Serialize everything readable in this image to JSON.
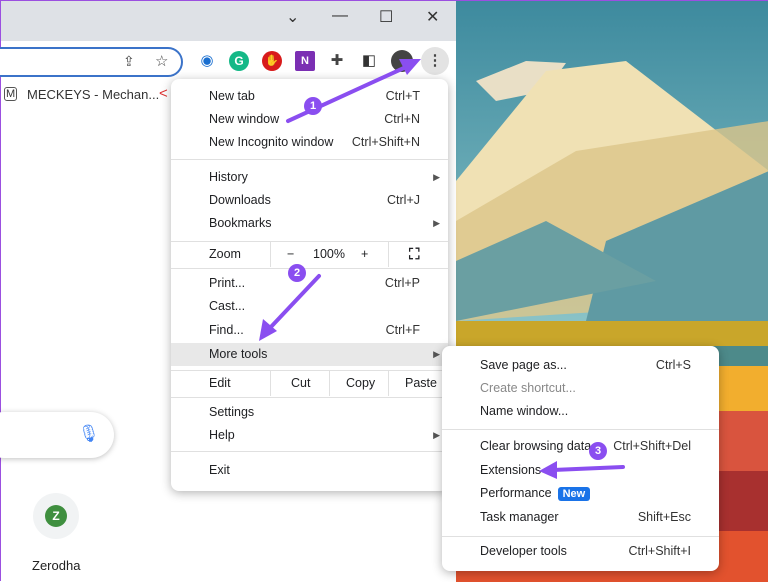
{
  "window": {
    "controls": [
      "chevron-down",
      "minimize",
      "maximize",
      "close"
    ]
  },
  "toolbar": {
    "extensions": [
      "1password",
      "grammarly",
      "adblock",
      "onenote",
      "extensions-puzzle",
      "side-panel",
      "profile-avatar",
      "menu-kebab"
    ]
  },
  "bookmarks": [
    {
      "label": "MECKEYS - Mechan..."
    }
  ],
  "shortcut": {
    "letter": "Z",
    "label": "Zerodha"
  },
  "main_menu": {
    "new_tab": {
      "label": "New tab",
      "shortcut": "Ctrl+T"
    },
    "new_window": {
      "label": "New window",
      "shortcut": "Ctrl+N"
    },
    "incognito": {
      "label": "New Incognito window",
      "shortcut": "Ctrl+Shift+N"
    },
    "history": {
      "label": "History"
    },
    "downloads": {
      "label": "Downloads",
      "shortcut": "Ctrl+J"
    },
    "bookmarks": {
      "label": "Bookmarks"
    },
    "zoom": {
      "label": "Zoom",
      "minus": "−",
      "value": "100%",
      "plus": "+"
    },
    "print": {
      "label": "Print...",
      "shortcut": "Ctrl+P"
    },
    "cast": {
      "label": "Cast..."
    },
    "find": {
      "label": "Find...",
      "shortcut": "Ctrl+F"
    },
    "more_tools": {
      "label": "More tools"
    },
    "edit": {
      "label": "Edit",
      "cut": "Cut",
      "copy": "Copy",
      "paste": "Paste"
    },
    "settings": {
      "label": "Settings"
    },
    "help": {
      "label": "Help"
    },
    "exit": {
      "label": "Exit"
    }
  },
  "sub_menu": {
    "save_page": {
      "label": "Save page as...",
      "shortcut": "Ctrl+S"
    },
    "create_shortcut": {
      "label": "Create shortcut..."
    },
    "name_window": {
      "label": "Name window..."
    },
    "clear_data": {
      "label": "Clear browsing data...",
      "shortcut": "Ctrl+Shift+Del"
    },
    "extensions": {
      "label": "Extensions"
    },
    "performance": {
      "label": "Performance",
      "badge": "New"
    },
    "task_manager": {
      "label": "Task manager",
      "shortcut": "Shift+Esc"
    },
    "dev_tools": {
      "label": "Developer tools",
      "shortcut": "Ctrl+Shift+I"
    }
  },
  "annotations": {
    "step1": "1",
    "step2": "2",
    "step3": "3",
    "color": "#8a4ef0"
  }
}
